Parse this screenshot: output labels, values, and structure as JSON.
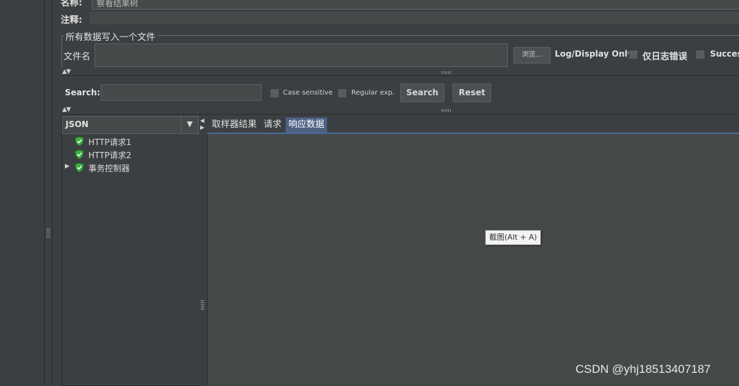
{
  "form": {
    "name_label": "名称:",
    "name_value": "察看结果树",
    "comment_label": "注释:",
    "file_group_title": "所有数据写入一个文件",
    "filename_label": "文件名",
    "browse_label": "浏览...",
    "log_display_label": "Log/Display Only:",
    "errors_label": "仅日志错误",
    "success_label": "Successes"
  },
  "search": {
    "label": "Search:",
    "value": "",
    "case_sensitive_label": "Case sensitive",
    "regex_label": "Regular exp.",
    "search_button": "Search",
    "reset_button": "Reset"
  },
  "tree": {
    "renderer_selected": "JSON",
    "items": [
      {
        "label": "HTTP请求1",
        "status": "success",
        "icon": "shield-check-icon"
      },
      {
        "label": "HTTP请求2",
        "status": "success",
        "icon": "shield-check-icon"
      },
      {
        "label": "事务控制器",
        "status": "success",
        "icon": "shield-check-icon",
        "expandable": true
      }
    ]
  },
  "tabs": [
    {
      "label": "取样器结果",
      "active": false
    },
    {
      "label": "请求",
      "active": false
    },
    {
      "label": "响应数据",
      "active": true
    }
  ],
  "tooltip": "截图(Alt + A)",
  "watermark": "CSDN @yhj18513407187",
  "colors": {
    "background": "#3c3f41",
    "field": "#45494a",
    "active_tab": "#4d6185",
    "success_icon": "#3cb043"
  }
}
